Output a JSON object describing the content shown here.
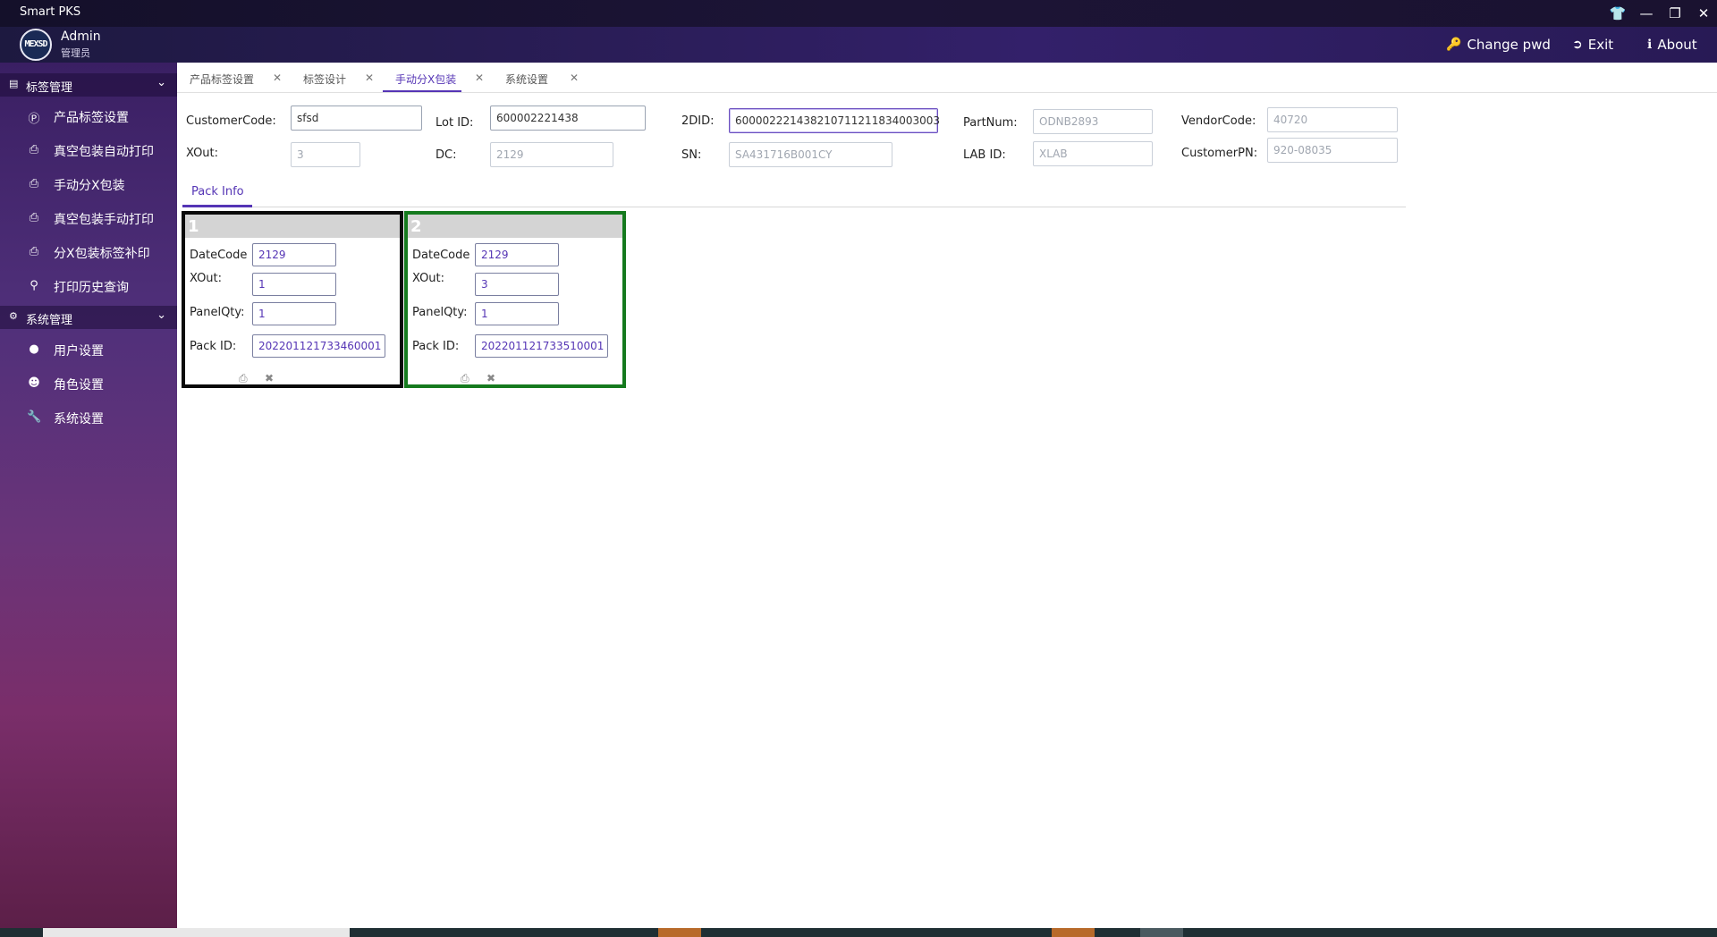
{
  "window": {
    "title": "Smart PKS",
    "controls": [
      "shirt-icon",
      "minimize-icon",
      "restore-icon",
      "close-icon"
    ]
  },
  "header": {
    "logo_text": "MEXSD",
    "user_name": "Admin",
    "user_role": "管理员",
    "actions": {
      "change_pwd": "Change pwd",
      "exit": "Exit",
      "about": "About"
    }
  },
  "sidebar": {
    "groups": [
      {
        "label": "标签管理",
        "items": [
          {
            "label": "产品标签设置",
            "icon": "p-circle-icon"
          },
          {
            "label": "真空包装自动打印",
            "icon": "printer-icon"
          },
          {
            "label": "手动分X包装",
            "icon": "printer-icon"
          },
          {
            "label": "真空包装手动打印",
            "icon": "printer-icon"
          },
          {
            "label": "分X包装标签补印",
            "icon": "printer-icon"
          },
          {
            "label": "打印历史查询",
            "icon": "search-icon"
          }
        ]
      },
      {
        "label": "系统管理",
        "items": [
          {
            "label": "用户设置",
            "icon": "user-icon"
          },
          {
            "label": "角色设置",
            "icon": "users-icon"
          },
          {
            "label": "系统设置",
            "icon": "wrench-icon"
          }
        ]
      }
    ]
  },
  "tabs": [
    {
      "label": "产品标签设置",
      "active": false
    },
    {
      "label": "标签设计",
      "active": false
    },
    {
      "label": "手动分X包装",
      "active": true
    },
    {
      "label": "系统设置",
      "active": false
    }
  ],
  "form": {
    "customer_code": {
      "label": "CustomerCode:",
      "value": "sfsd"
    },
    "lot_id": {
      "label": "Lot ID:",
      "value": "600002221438"
    },
    "two_did": {
      "label": "2DID:",
      "value": "600002221438210711211834003003"
    },
    "part_num": {
      "label": "PartNum:",
      "value": "ODNB2893"
    },
    "vendor_code": {
      "label": "VendorCode:",
      "value": "40720"
    },
    "xout": {
      "label": "XOut:",
      "value": "3"
    },
    "dc": {
      "label": "DC:",
      "value": "2129"
    },
    "sn": {
      "label": "SN:",
      "value": "SA431716B001CY"
    },
    "lab_id": {
      "label": "LAB ID:",
      "value": "XLAB"
    },
    "customer_pn": {
      "label": "CustomerPN:",
      "value": "920-08035"
    }
  },
  "pack_info": {
    "tab_label": "Pack Info",
    "field_labels": {
      "date_code": "DateCode",
      "xout": "XOut:",
      "panel_qty": "PanelQty:",
      "pack_id": "Pack ID:"
    },
    "cards": [
      {
        "number": "1",
        "date_code": "2129",
        "xout": "1",
        "panel_qty": "1",
        "pack_id": "202201121733460001",
        "border_color": "#0a0a0a"
      },
      {
        "number": "2",
        "date_code": "2129",
        "xout": "3",
        "panel_qty": "1",
        "pack_id": "202201121733510001",
        "border_color": "#157a1e"
      }
    ]
  },
  "colors": {
    "accent": "#5535b5",
    "header_bg": "#2a1d57",
    "card1_border": "#0a0a0a",
    "card2_border": "#157a1e"
  }
}
